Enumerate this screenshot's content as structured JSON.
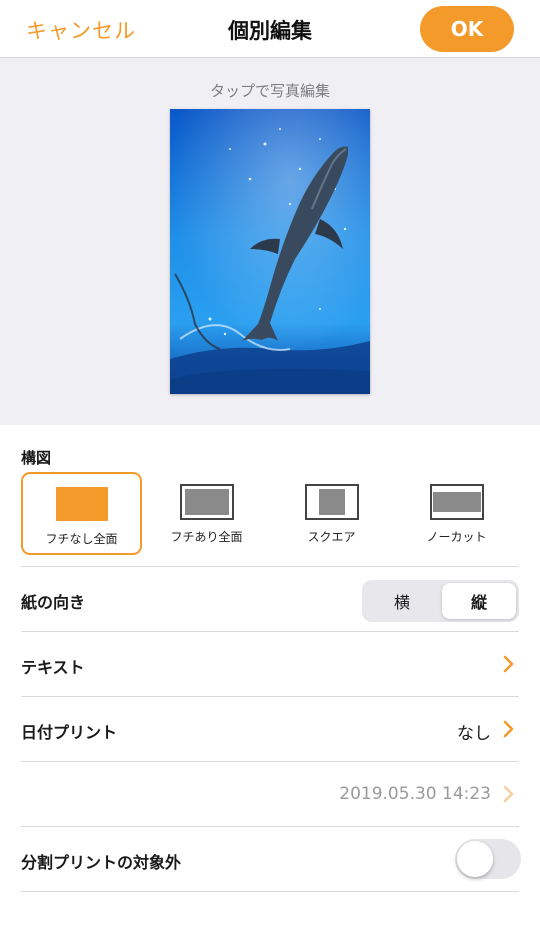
{
  "header": {
    "cancel_label": "キャンセル",
    "title": "個別編集",
    "ok_label": "OK"
  },
  "preview": {
    "hint": "タップで写真編集"
  },
  "composition": {
    "label": "構図",
    "options": [
      {
        "label": "フチなし全面",
        "selected": true
      },
      {
        "label": "フチあり全面",
        "selected": false
      },
      {
        "label": "スクエア",
        "selected": false
      },
      {
        "label": "ノーカット",
        "selected": false
      }
    ]
  },
  "orientation": {
    "label": "紙の向き",
    "options": [
      "横",
      "縦"
    ],
    "selected": "縦"
  },
  "text_row": {
    "label": "テキスト"
  },
  "date_print": {
    "label": "日付プリント",
    "value": "なし"
  },
  "date_value": {
    "value": "2019.05.30 14:23"
  },
  "exclude_split": {
    "label": "分割プリントの対象外",
    "on": false
  },
  "colors": {
    "accent": "#f39a2b",
    "background_gray": "#efeff4",
    "separator": "#d9d9dd"
  },
  "icons": [
    "chevron-right-icon",
    "layout-borderless-icon",
    "layout-bordered-icon",
    "layout-square-icon",
    "layout-nocut-icon"
  ]
}
